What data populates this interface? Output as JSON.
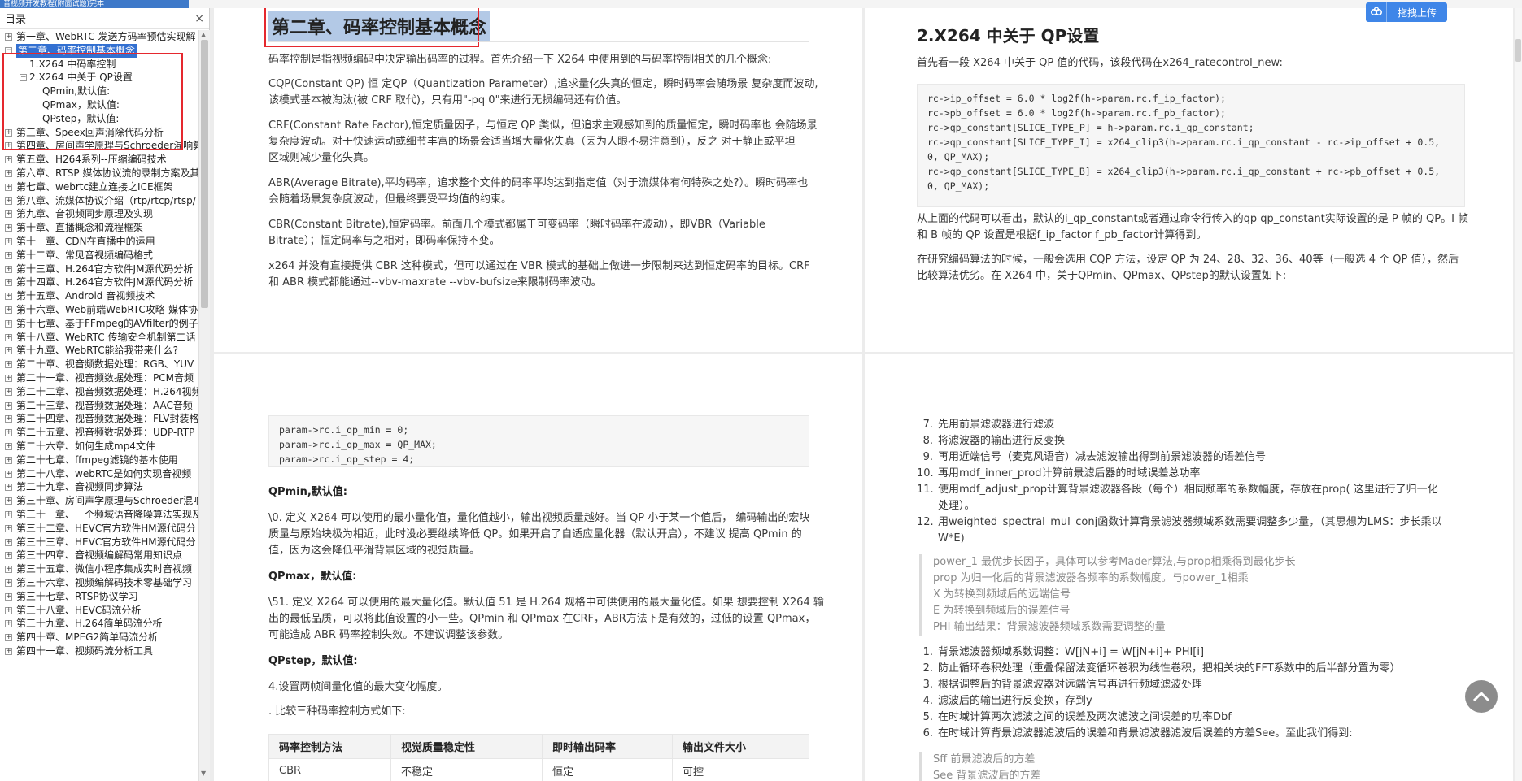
{
  "window": {
    "tab_title": "音视频开发教程(附面试题)完本"
  },
  "sidebar": {
    "title": "目录",
    "close_glyph": "×",
    "items": [
      {
        "label": "第一章、WebRTC 发送方码率预估实现解",
        "toggle": "+"
      },
      {
        "label": "第二章、码率控制基本概念",
        "toggle": "−",
        "selected": true
      },
      {
        "label": "1.X264 中码率控制"
      },
      {
        "label": "2.X264 中关于 QP设置",
        "toggle": "−"
      },
      {
        "label": "QPmin,默认值:"
      },
      {
        "label": "QPmax，默认值:"
      },
      {
        "label": "QPstep，默认值:"
      },
      {
        "label": "第三章、Speex回声消除代码分析",
        "toggle": "+"
      },
      {
        "label": "第四章、房间声学原理与Schroeder混响算",
        "toggle": "+"
      },
      {
        "label": "第五章、H264系列--压缩编码技术",
        "toggle": "+"
      },
      {
        "label": "第六章、RTSP 媒体协议流的录制方案及其",
        "toggle": "+"
      },
      {
        "label": "第七章、webrtc建立连接之ICE框架",
        "toggle": "+"
      },
      {
        "label": "第八章、流媒体协议介绍（rtp/rtcp/rtsp/",
        "toggle": "+"
      },
      {
        "label": "第九章、音视频同步原理及实现",
        "toggle": "+"
      },
      {
        "label": "第十章、直播概念和流程框架",
        "toggle": "+"
      },
      {
        "label": "第十一章、CDN在直播中的运用",
        "toggle": "+"
      },
      {
        "label": "第十二章、常见音视频编码格式",
        "toggle": "+"
      },
      {
        "label": "第十三章、H.264官方软件JM源代码分析",
        "toggle": "+"
      },
      {
        "label": "第十四章、H.264官方软件JM源代码分析",
        "toggle": "+"
      },
      {
        "label": "第十五章、Android 音视频技术",
        "toggle": "+"
      },
      {
        "label": "第十六章、Web前端WebRTC攻略-媒体协",
        "toggle": "+"
      },
      {
        "label": "第十七章、基于FFmpeg的AVfilter的例子",
        "toggle": "+"
      },
      {
        "label": "第十八章、WebRTC 传输安全机制第二话",
        "toggle": "+"
      },
      {
        "label": "第十九章、WebRTC能给我带来什么?",
        "toggle": "+"
      },
      {
        "label": "第二十章、视音频数据处理：RGB、YUV",
        "toggle": "+"
      },
      {
        "label": "第二十一章、视音频数据处理：PCM音频",
        "toggle": "+"
      },
      {
        "label": "第二十二章、视音频数据处理：H.264视频",
        "toggle": "+"
      },
      {
        "label": "第二十三章、视音频数据处理：AAC音频",
        "toggle": "+"
      },
      {
        "label": "第二十四章、视音频数据处理：FLV封装格",
        "toggle": "+"
      },
      {
        "label": "第二十五章、视音频数据处理：UDP-RTP",
        "toggle": "+"
      },
      {
        "label": "第二十六章、如何生成mp4文件",
        "toggle": "+"
      },
      {
        "label": "第二十七章、ffmpeg滤镜的基本使用",
        "toggle": "+"
      },
      {
        "label": "第二十八章、webRTC是如何实现音视频",
        "toggle": "+"
      },
      {
        "label": "第二十九章、音视频同步算法",
        "toggle": "+"
      },
      {
        "label": "第三十章、房间声学原理与Schroeder混响",
        "toggle": "+"
      },
      {
        "label": "第三十一章、一个频域语音降噪算法实现及",
        "toggle": "+"
      },
      {
        "label": "第三十二章、HEVC官方软件HM源代码分",
        "toggle": "+"
      },
      {
        "label": "第三十三章、HEVC官方软件HM源代码分",
        "toggle": "+"
      },
      {
        "label": "第三十四章、音视频编解码常用知识点",
        "toggle": "+"
      },
      {
        "label": "第三十五章、微信小程序集成实时音视频",
        "toggle": "+"
      },
      {
        "label": "第三十六章、视频编解码技术零基础学习",
        "toggle": "+"
      },
      {
        "label": "第三十七章、RTSP协议学习",
        "toggle": "+"
      },
      {
        "label": "第三十八章、HEVC码流分析",
        "toggle": "+"
      },
      {
        "label": "第三十九章、H.264简单码流分析",
        "toggle": "+"
      },
      {
        "label": "第四十章、MPEG2简单码流分析",
        "toggle": "+"
      },
      {
        "label": "第四十一章、视频码流分析工具",
        "toggle": "+"
      }
    ]
  },
  "page1": {
    "title": "第二章、码率控制基本概念",
    "p1": "码率控制是指视频编码中决定输出码率的过程。首先介绍一下 X264 中使用到的与码率控制相关的几个概念:",
    "p2a": "CQP(Constant QP) 恒 定QP（Quantization Parameter）,追求量化失真的恒定，瞬时码率会随场景 复杂度而波动,",
    "p2b": "该模式基本被淘汰(被 CRF 取代)，只有用\"-pq 0\"来进行无损编码还有价值。",
    "p3a": "CRF(Constant Rate Factor),恒定质量因子，与恒定 QP 类似，但追求主观感知到的质量恒定，瞬时码率也 会随场景",
    "p3b": "复杂度波动。对于快速运动或细节丰富的场景会适当增大量化失真（因为人眼不易注意到），反之 对于静止或平坦",
    "p3c": "区域则减少量化失真。",
    "p4a": "ABR(Average Bitrate),平均码率，追求整个文件的码率平均达到指定值（对于流媒体有何特殊之处?）。瞬时码率也",
    "p4b": "会随着场景复杂度波动，但最终要受平均值的约束。",
    "p5a": "CBR(Constant Bitrate),恒定码率。前面几个模式都属于可变码率（瞬时码率在波动），即VBR（Variable",
    "p5b": "Bitrate）；恒定码率与之相对，即码率保持不变。",
    "p6a": "x264 并没有直接提供 CBR 这种模式，但可以通过在 VBR 模式的基础上做进一步限制来达到恒定码率的目标。CRF",
    "p6b": "和 ABR 模式都能通过--vbv-maxrate --vbv-bufsize来限制码率波动。"
  },
  "page2": {
    "title": "2.X264 中关于 QP设置",
    "intro": "首先看一段 X264 中关于 QP 值的代码，该段代码在x264_ratecontrol_new:",
    "code": "rc->ip_offset = 6.0 * log2f(h->param.rc.f_ip_factor);\nrc->pb_offset = 6.0 * log2f(h->param.rc.f_pb_factor);\nrc->qp_constant[SLICE_TYPE_P] = h->param.rc.i_qp_constant;\nrc->qp_constant[SLICE_TYPE_I] = x264_clip3(h->param.rc.i_qp_constant - rc->ip_offset + 0.5,\n0, QP_MAX);\nrc->qp_constant[SLICE_TYPE_B] = x264_clip3(h->param.rc.i_qp_constant + rc->pb_offset + 0.5,\n0, QP_MAX);",
    "p1a": "从上面的代码可以看出，默认的i_qp_constant或者通过命令行传入的qp qp_constant实际设置的是 P 帧的 QP。I 帧",
    "p1b": "和 B 帧的 QP 设置是根据f_ip_factor f_pb_factor计算得到。",
    "p2a": "在研究编码算法的时候，一般会选用 CQP 方法，设定 QP 为 24、28、32、36、40等（一般选 4 个 QP 值），然后",
    "p2b": "比较算法优劣。在 X264 中，关于QPmin、QPmax、QPstep的默认设置如下:"
  },
  "page3": {
    "code": "param->rc.i_qp_min = 0;\nparam->rc.i_qp_max = QP_MAX;\nparam->rc.i_qp_step = 4;",
    "qpmin_h": "QPmin,默认值:",
    "qpmin_a": "\\0. 定义 X264 可以使用的最小量化值，量化值越小，输出视频质量越好。当 QP 小于某一个值后， 编码输出的宏块",
    "qpmin_b": "质量与原始块极为相近，此时没必要继续降低 QP。如果开启了自适应量化器（默认开启），不建议 提高 QPmin 的",
    "qpmin_c": "值，因为这会降低平滑背景区域的视觉质量。",
    "qpmax_h": "QPmax，默认值:",
    "qpmax_a": "\\51. 定义 X264 可以使用的最大量化值。默认值 51 是 H.264 规格中可供使用的最大量化值。如果 想要控制 X264 输",
    "qpmax_b": "出的最低品质，可以将此值设置的小一些。QPmin 和 QPmax 在CRF，ABR方法下是有效的，过低的设置 QPmax，",
    "qpmax_c": "可能造成 ABR 码率控制失效。不建议调整该参数。",
    "qpstep_h": "QPstep，默认值:",
    "qpstep_a": "4.设置两帧间量化值的最大变化幅度。",
    "compare": ". 比较三种码率控制方式如下:",
    "table": {
      "headers": [
        "码率控制方法",
        "视觉质量稳定性",
        "即时输出码率",
        "输出文件大小"
      ],
      "rows": [
        [
          "CBR",
          "不稳定",
          "恒定",
          "可控"
        ]
      ]
    }
  },
  "page4": {
    "list1": [
      {
        "n": "7.",
        "t": "先用前景滤波器进行滤波"
      },
      {
        "n": "8.",
        "t": "将滤波器的输出进行反变换"
      },
      {
        "n": "9.",
        "t": "再用近端信号（麦克风语音）减去滤波输出得到前景滤波器的语差信号"
      },
      {
        "n": "10.",
        "t": "再用mdf_inner_prod计算前景滤后器的时域误差总功率"
      },
      {
        "n": "11.",
        "t": "使用mdf_adjust_prop计算背景滤波器各段（每个）相同频率的系数幅度，存放在prop( 这里进行了归一化处理）。"
      },
      {
        "n": "12.",
        "t": "用weighted_spectral_mul_conj函数计算背景滤波器频域系数需要调整多少量，（其思想为LMS：步长乘以W*E)"
      }
    ],
    "quote1": [
      "power_1 最优步长因子，具体可以参考Mader算法,与prop相乘得到最化步长",
      "prop 为归一化后的背景滤波器各频率的系数幅度。与power_1相乘",
      "X 为转换到频域后的远端信号",
      "E 为转换到频域后的误差信号",
      "PHI 输出结果：背景滤波器频域系数需要调整的量"
    ],
    "list2": [
      {
        "n": "1.",
        "t": "背景滤波器频域系数调整：W[jN+i] = W[jN+i]+ PHI[i]"
      },
      {
        "n": "2.",
        "t": "防止循环卷积处理（重叠保留法变循环卷积为线性卷积，把相关块的FFT系数中的后半部分置为零）"
      },
      {
        "n": "3.",
        "t": "根据调整后的背景滤波器对远端信号再进行频域滤波处理"
      },
      {
        "n": "4.",
        "t": "滤波后的输出进行反变换，存到y"
      },
      {
        "n": "5.",
        "t": "在时域计算两次滤波之间的误差及两次滤波之间误差的功率Dbf"
      },
      {
        "n": "6.",
        "t": "在时域计算背景滤波器滤波后的误差和背景滤波器滤波后误差的方差See。至此我们得到:"
      }
    ],
    "quote2": [
      "Sff 前景滤波后的方差",
      "See 背景滤波后的方差"
    ]
  },
  "upload": {
    "label": "拖拽上传"
  }
}
